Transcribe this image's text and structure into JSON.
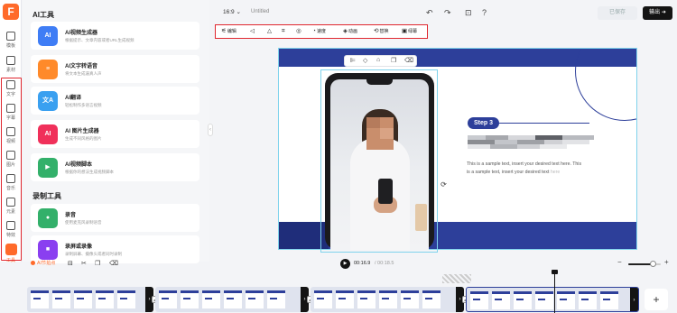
{
  "app": {
    "logo": "F"
  },
  "rail": {
    "items": [
      {
        "label": "模板",
        "icon": "template-icon"
      },
      {
        "label": "素材",
        "icon": "folder-icon"
      },
      {
        "label": "文字",
        "icon": "text-icon"
      },
      {
        "label": "字幕",
        "icon": "subtitle-icon"
      },
      {
        "label": "视频",
        "icon": "video-icon"
      },
      {
        "label": "图片",
        "icon": "image-icon"
      },
      {
        "label": "音乐",
        "icon": "music-icon"
      },
      {
        "label": "元素",
        "icon": "element-icon"
      },
      {
        "label": "特效",
        "icon": "effect-icon"
      },
      {
        "label": "工具",
        "icon": "tools-icon"
      }
    ]
  },
  "panel": {
    "ai_title": "AI工具",
    "ai_tools": [
      {
        "name": "AI视频生成器",
        "desc": "根据提示、文章内容或者URL生成视频",
        "icon": "AI",
        "color": "#3f7df5"
      },
      {
        "name": "AI文字转语音",
        "desc": "将文本生成逼真人声",
        "icon": "≡",
        "color": "#ff8a2a"
      },
      {
        "name": "AI翻译",
        "desc": "轻松制作多语言视频",
        "icon": "文A",
        "color": "#3aa0f0"
      },
      {
        "name": "AI 图片生成器",
        "desc": "生成不同风格的图片",
        "icon": "AI",
        "color": "#f0305a"
      },
      {
        "name": "AI视频脚本",
        "desc": "根据你的想法生成视频脚本",
        "icon": "▶",
        "color": "#33b06a"
      }
    ],
    "rec_title": "录制工具",
    "rec_tools": [
      {
        "name": "录音",
        "desc": "使用麦克风录制语音",
        "icon": "●",
        "color": "#33b06a"
      },
      {
        "name": "录屏或录像",
        "desc": "录制屏幕、摄像头或者同时录制",
        "icon": "■",
        "color": "#8a3ff0"
      }
    ]
  },
  "topbar": {
    "ratio": "16:9",
    "doc_title": "Untitled",
    "saved": "已保存",
    "export": "输出"
  },
  "edit_toolbar": {
    "items": [
      {
        "label": "编辑",
        "icon": "sliders-icon"
      },
      {
        "label": "",
        "icon": "volume-icon"
      },
      {
        "label": "",
        "icon": "flip-icon"
      },
      {
        "label": "",
        "icon": "crop-icon"
      },
      {
        "label": "",
        "icon": "mask-icon"
      },
      {
        "label": "速度",
        "icon": "speed-icon"
      },
      {
        "label": "动画",
        "icon": "animation-icon"
      },
      {
        "label": "替换",
        "icon": "replace-icon"
      },
      {
        "label": "绿幕",
        "icon": "greenscreen-icon"
      }
    ]
  },
  "slide": {
    "step": "Step 3",
    "text": "This is a sample text, insert your desired text here. This is a sample text, insert your desired text",
    "text_faded": "here"
  },
  "timeline": {
    "ai_beat": "AI节拍点",
    "current_time": "00:16.9",
    "total_time": "/ 00:18.5",
    "zoom_level": 0.75
  }
}
